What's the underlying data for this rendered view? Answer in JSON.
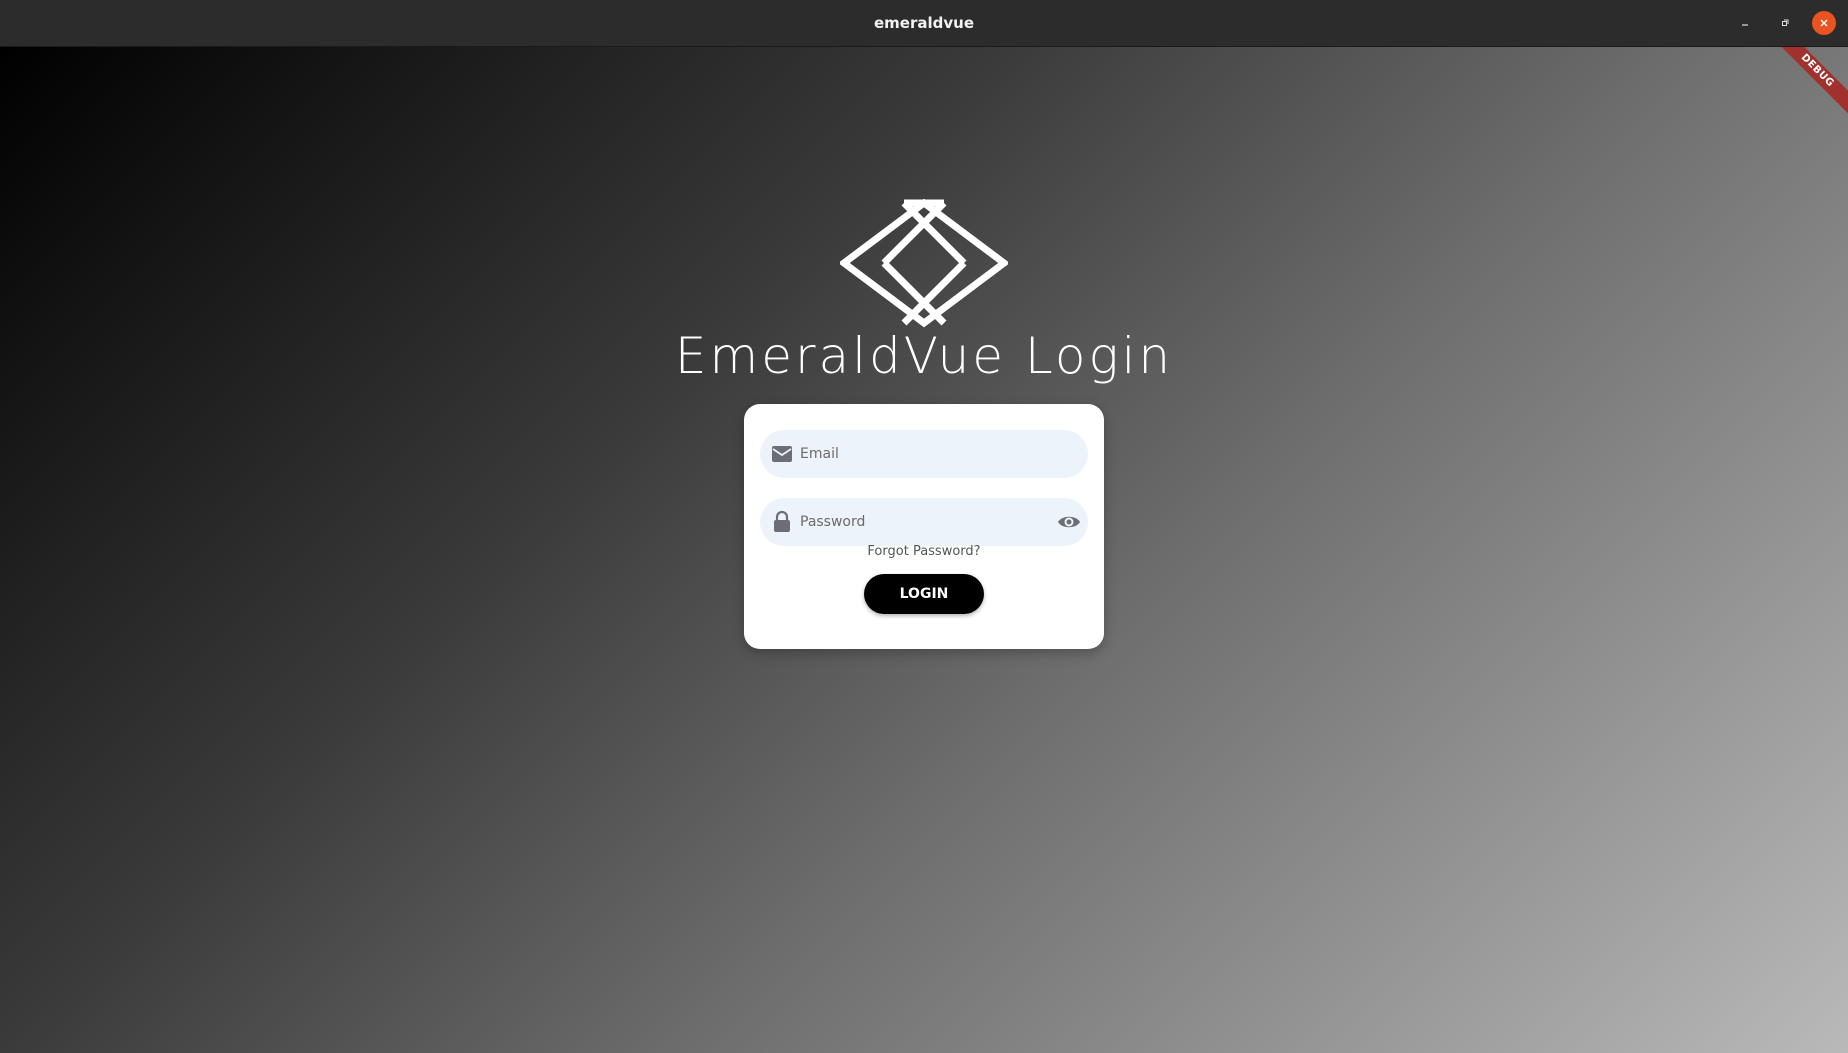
{
  "window": {
    "title": "emeraldvue",
    "controls": {
      "minimize": "minimize-icon",
      "maximize": "maximize-icon",
      "close": "close-icon"
    },
    "close_color": "#e95420"
  },
  "debug_banner": "DEBUG",
  "login": {
    "heading": "EmeraldVue Login",
    "email": {
      "placeholder": "Email",
      "value": "",
      "icon": "mail-icon"
    },
    "password": {
      "placeholder": "Password",
      "value": "",
      "icon": "lock-icon",
      "toggle_icon": "eye-icon"
    },
    "forgot_password": "Forgot Password?",
    "submit_label": "LOGIN"
  },
  "colors": {
    "field_background": "#edf3fb",
    "button_background": "#000000",
    "debug_ribbon": "#a0312d"
  }
}
